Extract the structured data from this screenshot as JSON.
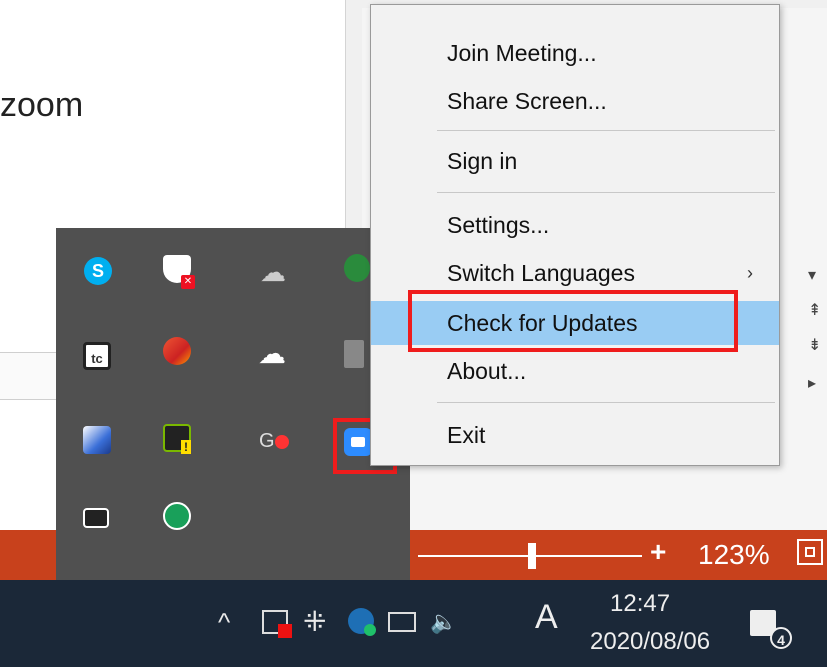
{
  "document": {
    "label": "zoom"
  },
  "context_menu": {
    "items": [
      {
        "label": "Join Meeting..."
      },
      {
        "label": "Share Screen..."
      },
      {
        "label": "Sign in"
      },
      {
        "label": "Settings..."
      },
      {
        "label": "Switch Languages",
        "submenu": true
      },
      {
        "label": "Check for Updates",
        "highlighted": true
      },
      {
        "label": "About..."
      },
      {
        "label": "Exit"
      }
    ],
    "submenu_glyph": "›"
  },
  "status_bar": {
    "zoom_minus": "—",
    "zoom_plus": "+",
    "zoom_level": "123%"
  },
  "taskbar": {
    "show_hidden_glyph": "^",
    "ime_label": "A",
    "clock_time": "12:47",
    "clock_date": "2020/08/06",
    "notification_count": "4",
    "volume_glyph": "🔈"
  },
  "tray_icons": [
    "skype-icon",
    "security-shield-icon",
    "cloud-off-icon",
    "edge-icon",
    "tc-icon",
    "ccleaner-icon",
    "upload-icon",
    "printer-icon",
    "box-icon",
    "nvidia-icon",
    "record-icon",
    "zoom-icon",
    "mail-icon",
    "green-app-icon"
  ],
  "tray_labels": {
    "skype": "S",
    "tc": "tc",
    "upload": "☁",
    "cloud_off": "☁",
    "record": "G",
    "dropbox": "⁜"
  },
  "colors": {
    "accent_highlight": "#99ccf3",
    "annotation_red": "#ef1c1c",
    "status_bar": "#c8411c",
    "taskbar": "#1b2838",
    "zoom_blue": "#2d8cff"
  }
}
